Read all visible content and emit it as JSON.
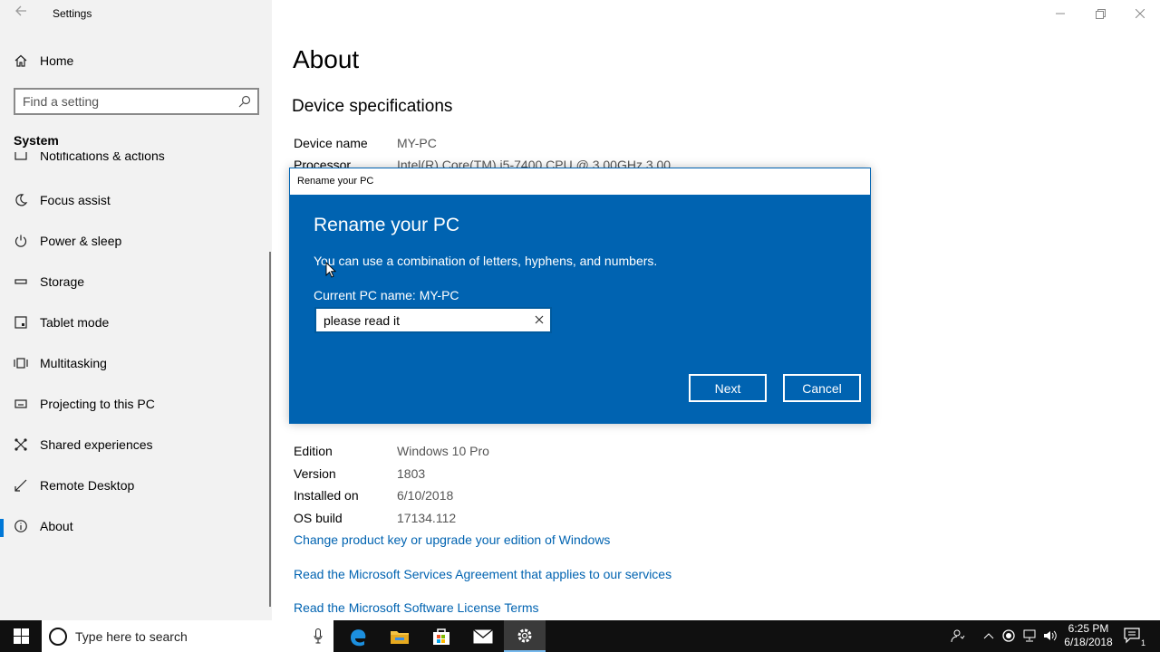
{
  "window": {
    "app_title": "Settings"
  },
  "sidebar": {
    "home_label": "Home",
    "search_placeholder": "Find a setting",
    "section_title": "System",
    "items": [
      {
        "label": "Notifications & actions",
        "icon": "notification-icon"
      },
      {
        "label": "Focus assist",
        "icon": "moon-icon"
      },
      {
        "label": "Power & sleep",
        "icon": "power-icon"
      },
      {
        "label": "Storage",
        "icon": "storage-icon"
      },
      {
        "label": "Tablet mode",
        "icon": "tablet-icon"
      },
      {
        "label": "Multitasking",
        "icon": "multitasking-icon"
      },
      {
        "label": "Projecting to this PC",
        "icon": "projector-icon"
      },
      {
        "label": "Shared experiences",
        "icon": "shared-icon"
      },
      {
        "label": "Remote Desktop",
        "icon": "remote-icon"
      },
      {
        "label": "About",
        "icon": "info-icon",
        "active": true
      }
    ]
  },
  "main": {
    "title": "About",
    "device_specs_title": "Device specifications",
    "device_specs": [
      {
        "key": "Device name",
        "value": "MY-PC"
      },
      {
        "key": "Processor",
        "value": "Intel(R) Core(TM) i5-7400 CPU @ 3.00GHz   3.00"
      }
    ],
    "windows_specs": [
      {
        "key": "Edition",
        "value": "Windows 10 Pro"
      },
      {
        "key": "Version",
        "value": "1803"
      },
      {
        "key": "Installed on",
        "value": "6/10/2018"
      },
      {
        "key": "OS build",
        "value": "17134.112"
      }
    ],
    "links": [
      "Change product key or upgrade your edition of Windows",
      "Read the Microsoft Services Agreement that applies to our services",
      "Read the Microsoft Software License Terms"
    ]
  },
  "dialog": {
    "titlebar": "Rename your PC",
    "heading": "Rename your PC",
    "description": "You can use a combination of letters, hyphens, and numbers.",
    "current_name_label": "Current PC name: MY-PC",
    "name_value": "please read it",
    "next_label": "Next",
    "cancel_label": "Cancel",
    "accent_color": "#0063b1"
  },
  "taskbar": {
    "search_placeholder": "Type here to search",
    "time": "6:25 PM",
    "date": "6/18/2018",
    "notification_count": "1"
  }
}
